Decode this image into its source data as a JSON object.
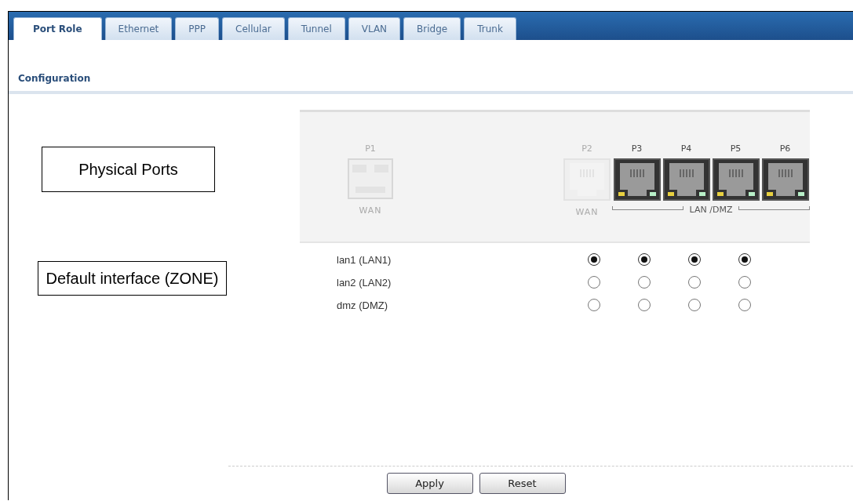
{
  "tabs": [
    {
      "label": "Port Role",
      "selected": true
    },
    {
      "label": "Ethernet",
      "selected": false
    },
    {
      "label": "PPP",
      "selected": false
    },
    {
      "label": "Cellular",
      "selected": false
    },
    {
      "label": "Tunnel",
      "selected": false
    },
    {
      "label": "VLAN",
      "selected": false
    },
    {
      "label": "Bridge",
      "selected": false
    },
    {
      "label": "Trunk",
      "selected": false
    }
  ],
  "section_title": "Configuration",
  "callouts": [
    "Physical Ports",
    "Default interface (ZONE)"
  ],
  "ports": [
    {
      "label": "P1",
      "role": "WAN",
      "kind": "sfp",
      "enabled": false
    },
    {
      "label": "P2",
      "role": "WAN",
      "kind": "rj45",
      "enabled": false
    },
    {
      "label": "P3",
      "kind": "rj45",
      "enabled": true
    },
    {
      "label": "P4",
      "kind": "rj45",
      "enabled": true
    },
    {
      "label": "P5",
      "kind": "rj45",
      "enabled": true
    },
    {
      "label": "P6",
      "kind": "rj45",
      "enabled": true
    }
  ],
  "group_label": "LAN /DMZ",
  "zones": [
    {
      "label": "lan1 (LAN1)",
      "choices": [
        {
          "selected": true
        },
        {
          "selected": true
        },
        {
          "selected": true
        },
        {
          "selected": true
        }
      ]
    },
    {
      "label": "lan2 (LAN2)",
      "choices": [
        {
          "selected": false
        },
        {
          "selected": false
        },
        {
          "selected": false
        },
        {
          "selected": false
        }
      ]
    },
    {
      "label": "dmz (DMZ)",
      "choices": [
        {
          "selected": false
        },
        {
          "selected": false
        },
        {
          "selected": false
        },
        {
          "selected": false
        }
      ]
    }
  ],
  "buttons": [
    "Apply",
    "Reset"
  ]
}
